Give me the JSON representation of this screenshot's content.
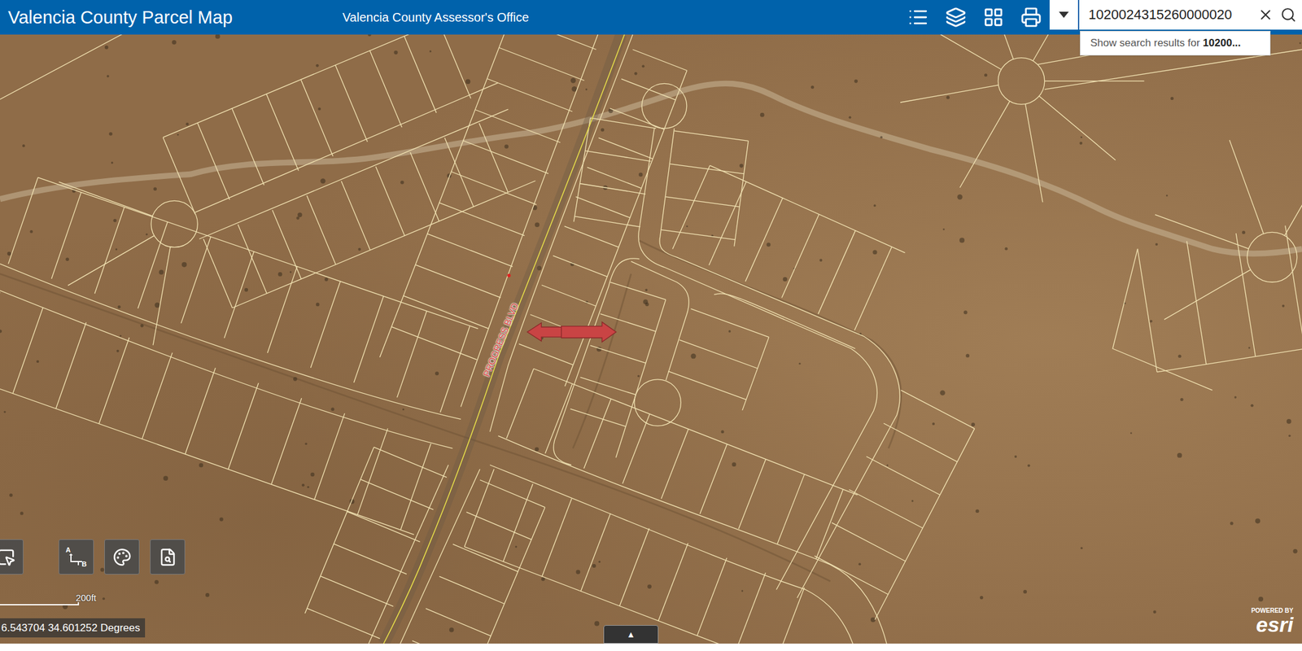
{
  "header": {
    "title": "Valencia County Parcel Map",
    "subtitle": "Valencia County Assessor's Office"
  },
  "search": {
    "value": "1020024315260000020",
    "suggestion_prefix": "Show search results for ",
    "suggestion_query": "10200..."
  },
  "map": {
    "road_label": "PROGRESS BLVD",
    "scale_label": "200ft",
    "coordinates": "6.543704 34.601252 Degrees",
    "attribution": {
      "powered_by": "POWERED BY",
      "logo": "esri"
    }
  },
  "route_tool": {
    "from": "A",
    "to": "B"
  },
  "panel_toggle": "▲"
}
